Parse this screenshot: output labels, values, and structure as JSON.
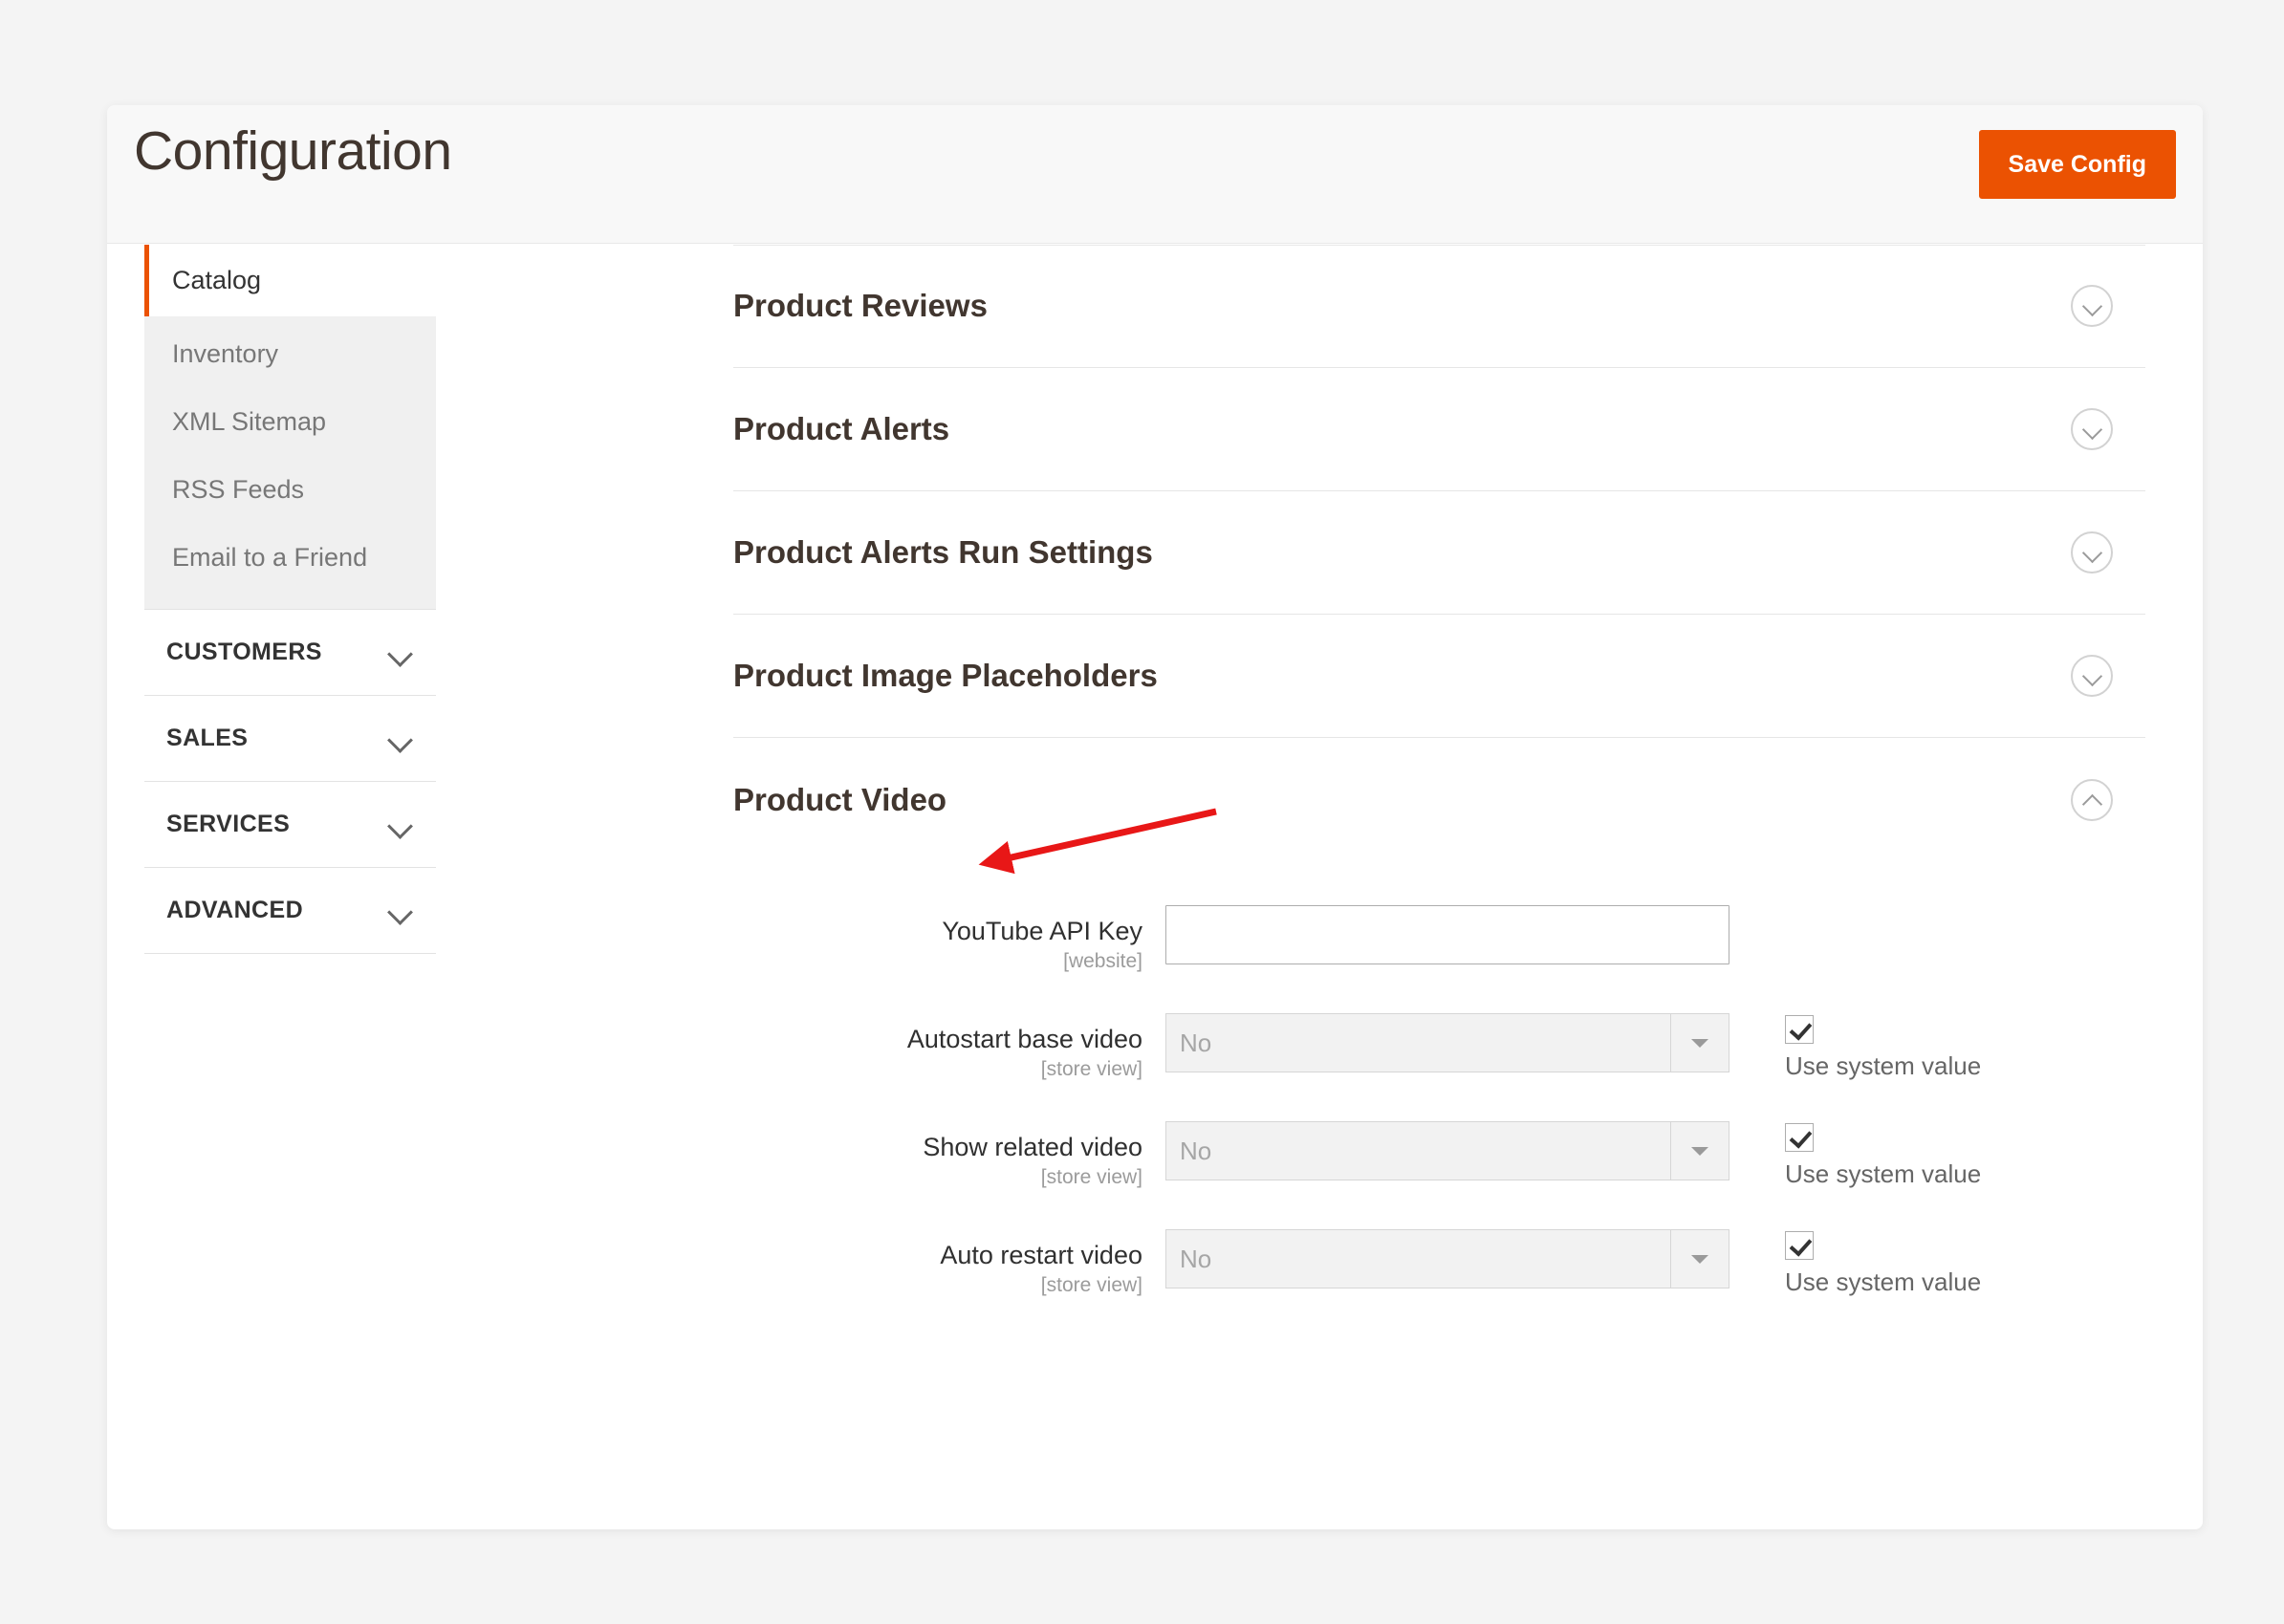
{
  "header": {
    "title": "Configuration",
    "save_label": "Save Config"
  },
  "sidebar": {
    "active_item": "Catalog",
    "sub_items": [
      {
        "label": "Inventory"
      },
      {
        "label": "XML Sitemap"
      },
      {
        "label": "RSS Feeds"
      },
      {
        "label": "Email to a Friend"
      }
    ],
    "groups": [
      {
        "label": "CUSTOMERS",
        "icon": "chevron-down-icon"
      },
      {
        "label": "SALES",
        "icon": "chevron-down-icon"
      },
      {
        "label": "SERVICES",
        "icon": "chevron-down-icon"
      },
      {
        "label": "ADVANCED",
        "icon": "chevron-down-icon"
      }
    ]
  },
  "main": {
    "sections": [
      {
        "title": "Product Reviews",
        "expanded": false,
        "icon": "chevron-down-circle-icon"
      },
      {
        "title": "Product Alerts",
        "expanded": false,
        "icon": "chevron-down-circle-icon"
      },
      {
        "title": "Product Alerts Run Settings",
        "expanded": false,
        "icon": "chevron-down-circle-icon"
      },
      {
        "title": "Product Image Placeholders",
        "expanded": false,
        "icon": "chevron-down-circle-icon"
      },
      {
        "title": "Product Video",
        "expanded": true,
        "icon": "chevron-up-circle-icon"
      }
    ],
    "fields": [
      {
        "label": "YouTube API Key",
        "scope": "[website]",
        "type": "text",
        "value": "",
        "has_system_value": false
      },
      {
        "label": "Autostart base video",
        "scope": "[store view]",
        "type": "select",
        "value": "No",
        "has_system_value": true,
        "system_value_label": "Use system value",
        "system_value_checked": true
      },
      {
        "label": "Show related video",
        "scope": "[store view]",
        "type": "select",
        "value": "No",
        "has_system_value": true,
        "system_value_label": "Use system value",
        "system_value_checked": true
      },
      {
        "label": "Auto restart video",
        "scope": "[store view]",
        "type": "select",
        "value": "No",
        "has_system_value": true,
        "system_value_label": "Use system value",
        "system_value_checked": true
      }
    ]
  },
  "annotation": {
    "type": "arrow",
    "color": "#e81717",
    "points_to": "Product Video"
  },
  "colors": {
    "accent": "#eb5202",
    "page_background": "#f4f4f4",
    "card_background": "#ffffff",
    "annotation_red": "#e81717"
  }
}
